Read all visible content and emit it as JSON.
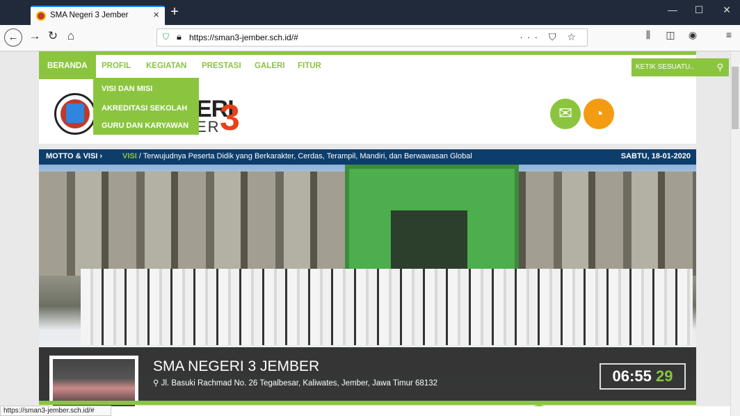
{
  "browser": {
    "tab_title": "SMA Negeri 3 Jember",
    "tab_close": "×",
    "new_tab": "+",
    "url": "https://sman3-jember.sch.id/#",
    "url_actions": "··· ⛉ ☆",
    "status_url": "https://sman3-jember.sch.id/#"
  },
  "nav": {
    "items": [
      "BERANDA",
      "PROFIL",
      "KEGIATAN",
      "PRESTASI",
      "GALERI",
      "FITUR"
    ],
    "search_placeholder": "KETIK SESUATU.."
  },
  "dropdown": {
    "items": [
      "VISI DAN MISI",
      "AKREDITASI SEKOLAH",
      "GURU DAN KARYAWAN"
    ]
  },
  "header": {
    "brand_line1": "ERI",
    "brand_line2": "ER",
    "brand_number": "3"
  },
  "motto": {
    "label": "MOTTO & VISI ›",
    "visi_label": "VISI",
    "visi_text": " / Terwujudnya Peserta Didik yang Berkarakter, Cerdas, Terampil, Mandiri, dan Berwawasan Global",
    "date": "SABTU, 18-01-2020"
  },
  "hero": {
    "school_name": "SMA NEGERI 3 JEMBER",
    "address": "Jl. Basuki Rachmad No. 26 Tegalbesar, Kaliwates, Jember, Jawa Timur 68132",
    "clock_hm": "06:55",
    "clock_s": "29"
  },
  "colors": {
    "accent": "#8bc53f",
    "motto_bg": "#0d3d6b",
    "rss": "#f39c12",
    "brand_red": "#e84118"
  }
}
